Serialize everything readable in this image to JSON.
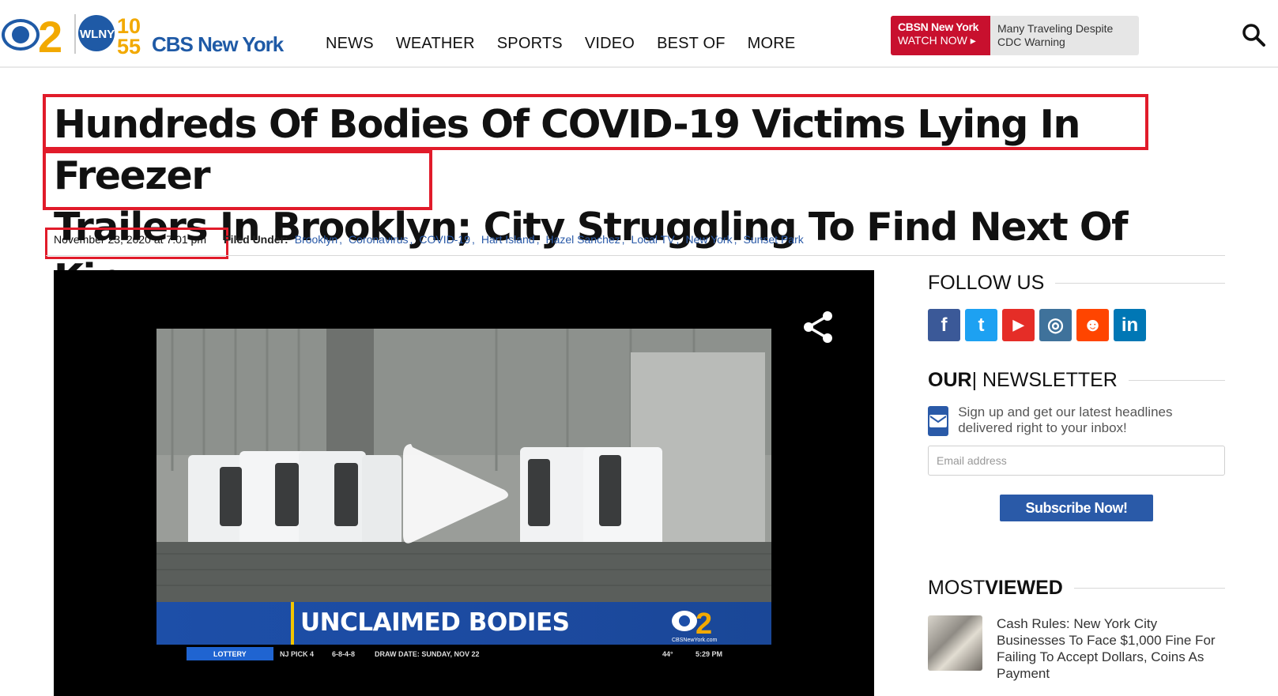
{
  "header": {
    "brand": {
      "cbs2_number": "2",
      "wlny_label": "WLNY",
      "ch_top": "10",
      "ch_bottom": "55",
      "brand_name": "CBS New York"
    },
    "nav": [
      "NEWS",
      "WEATHER",
      "SPORTS",
      "VIDEO",
      "BEST OF",
      "MORE"
    ],
    "promo": {
      "channel": "CBSN New York",
      "cta": "WATCH NOW ▸",
      "story": "Many Traveling Despite CDC Warning"
    }
  },
  "article": {
    "headline_line1": "Hundreds Of Bodies Of COVID-19 Victims Lying In Freezer",
    "headline_line2a": "Trailers In Brooklyn;",
    "headline_line2b": " City Struggling To Find Next Of Kin",
    "date": "November 23, 2020 at 7:01 pm",
    "filed_under_label": "Filed Under:",
    "tags": [
      "Brooklyn",
      "Coronavirus",
      "COVID-19",
      "Hart Island",
      "Hazel Sanchez",
      "Local TV",
      "New York",
      "Sunset Park"
    ]
  },
  "video": {
    "lower_third": "UNCLAIMED BODIES",
    "station_site": "CBSNewYork.com",
    "ticker": {
      "lottery": "LOTTERY",
      "game": "NJ PICK 4",
      "numbers": "6-8-4-8",
      "draw_date": "DRAW DATE:  SUNDAY, NOV 22",
      "temp": "44°",
      "time": "5:29 PM"
    }
  },
  "sidebar": {
    "follow_title": "FOLLOW US",
    "social": [
      {
        "name": "facebook",
        "glyph": "f",
        "color": "#3b5998"
      },
      {
        "name": "twitter",
        "glyph": "t",
        "color": "#1da1f2"
      },
      {
        "name": "youtube",
        "glyph": "▶",
        "color": "#e52d27"
      },
      {
        "name": "instagram",
        "glyph": "◎",
        "color": "#3f729b"
      },
      {
        "name": "reddit",
        "glyph": "☻",
        "color": "#ff4500"
      },
      {
        "name": "linkedin",
        "glyph": "in",
        "color": "#0077b5"
      }
    ],
    "newsletter_title_a": "OUR",
    "newsletter_title_b": " | NEWSLETTER",
    "newsletter_text": "Sign up and get our latest headlines delivered right to your inbox!",
    "email_placeholder": "Email address",
    "subscribe_label": "Subscribe Now!",
    "most_viewed_title_a": "MOST",
    "most_viewed_title_b": " VIEWED",
    "most_viewed": [
      {
        "title": "Cash Rules: New York City Businesses To Face $1,000 Fine For Failing To Accept Dollars, Coins As Payment"
      }
    ]
  }
}
